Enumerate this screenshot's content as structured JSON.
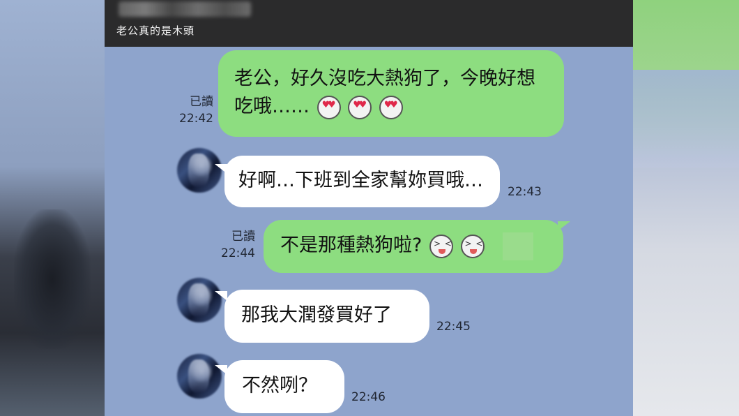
{
  "header": {
    "title": "老公真的是木頭"
  },
  "messages": [
    {
      "side": "out",
      "text_line1": "老公，好久沒吃大熱狗了，今晚好想",
      "text_line2": "吃哦……",
      "read": "已讀",
      "time": "22:42",
      "emojis": [
        "heart-eyes-emoji",
        "heart-eyes-emoji",
        "heart-eyes-emoji"
      ]
    },
    {
      "side": "in",
      "text": "好啊…下班到全家幫妳買哦…",
      "time": "22:43"
    },
    {
      "side": "out",
      "text": "不是那種熱狗啦?",
      "read": "已讀",
      "time": "22:44",
      "emojis": [
        "laughing-emoji",
        "laughing-emoji"
      ]
    },
    {
      "side": "in",
      "text": "那我大潤發買好了",
      "time": "22:45"
    },
    {
      "side": "in",
      "text": "不然咧？",
      "time": "22:46"
    }
  ],
  "colors": {
    "chat_bg": "#8ea4cc",
    "outgoing_bubble": "#8ddd80",
    "incoming_bubble": "#ffffff",
    "header_bg": "#2b2b2c"
  }
}
